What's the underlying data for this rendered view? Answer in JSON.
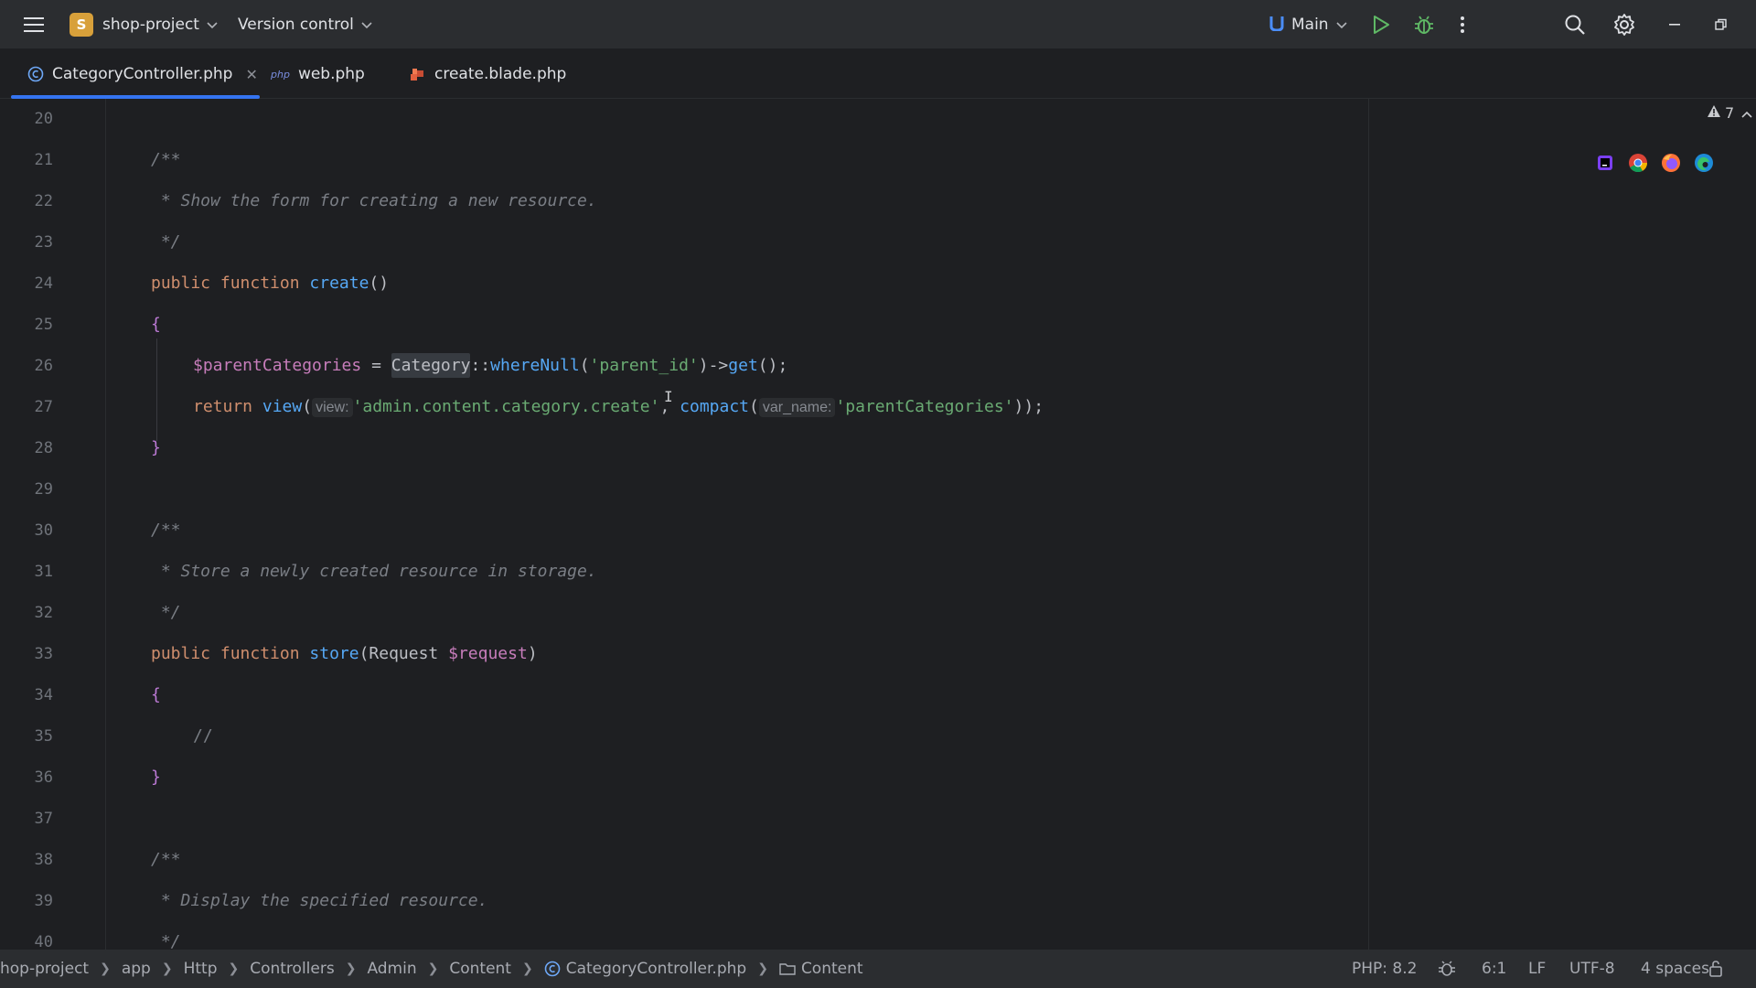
{
  "titlebar": {
    "project_initial": "S",
    "project_name": "shop-project",
    "vcs_label": "Version control",
    "branch": "Main"
  },
  "tabs": [
    {
      "label": "CategoryController.php",
      "active": true
    },
    {
      "label": "web.php",
      "icon_text": "php"
    },
    {
      "label": "create.blade.php"
    }
  ],
  "editor": {
    "warning_count": "7",
    "line_numbers": [
      "20",
      "21",
      "22",
      "23",
      "24",
      "25",
      "26",
      "27",
      "28",
      "29",
      "30",
      "31",
      "32",
      "33",
      "34",
      "35",
      "36",
      "37",
      "38",
      "39",
      "40"
    ],
    "lines": {
      "l21": "/**",
      "l22": " * Show the form for creating a new resource.",
      "l23": " */",
      "l24_kw": "public function ",
      "l24_fn": "create",
      "l24_rest": "()",
      "l25": "{",
      "l26_var": "$parentCategories",
      "l26_eq": " = ",
      "l26_cls": "Category",
      "l26_sep": "::",
      "l26_fn": "whereNull",
      "l26_p1": "(",
      "l26_str": "'parent_id'",
      "l26_p2": ")->",
      "l26_fn2": "get",
      "l26_end": "();",
      "l27_kw": "return ",
      "l27_fn": "view",
      "l27_p1": "(",
      "l27_hint1": "view:",
      "l27_str1": "'admin.content.category.create'",
      "l27_comma": ", ",
      "l27_fn2": "compact",
      "l27_p2": "(",
      "l27_hint2": "var_name:",
      "l27_str2": "'parentCategories'",
      "l27_end": "));",
      "l28": "}",
      "l30": "/**",
      "l31": " * Store a newly created resource in storage.",
      "l32": " */",
      "l33_kw": "public function ",
      "l33_fn": "store",
      "l33_p1": "(Request ",
      "l33_var": "$request",
      "l33_p2": ")",
      "l34": "{",
      "l35": "//",
      "l36": "}",
      "l38": "/**",
      "l39": " * Display the specified resource.",
      "l40": " */"
    }
  },
  "statusbar": {
    "breadcrumbs": [
      "hop-project",
      "app",
      "Http",
      "Controllers",
      "Admin",
      "Content",
      "CategoryController.php",
      "Content"
    ],
    "php_version": "PHP: 8.2",
    "position": "6:1",
    "line_ending": "LF",
    "encoding": "UTF-8",
    "indent": "4 spaces"
  },
  "colors": {
    "accent": "#3574f0",
    "background": "#1e1f22",
    "panel": "#2b2d30"
  }
}
